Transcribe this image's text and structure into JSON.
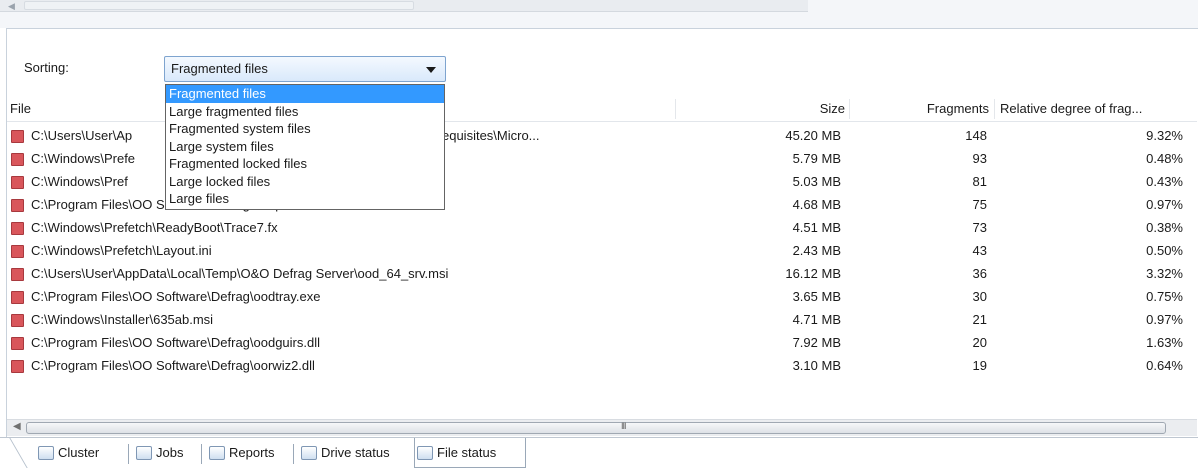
{
  "sorting": {
    "label": "Sorting:",
    "selected": "Fragmented files",
    "options": [
      "Fragmented files",
      "Large fragmented files",
      "Fragmented system files",
      "Large system files",
      "Fragmented locked files",
      "Large locked files",
      "Large files"
    ]
  },
  "columns": {
    "file": "File",
    "size": "Size",
    "fragments": "Fragments",
    "relative": "Relative degree of frag..."
  },
  "rows": [
    {
      "path": "C:\\Users\\User\\Ap",
      "path_suffix": "er\\ISSetupPrerequisites\\Micro...",
      "size": "45.20 MB",
      "fragments": "148",
      "relative": "9.32%"
    },
    {
      "path": "C:\\Windows\\Prefe",
      "path_suffix": "",
      "size": "5.79 MB",
      "fragments": "93",
      "relative": "0.48%"
    },
    {
      "path": "C:\\Windows\\Pref",
      "path_suffix": "",
      "size": "5.03 MB",
      "fragments": "81",
      "relative": "0.43%"
    },
    {
      "path": "C:\\Program Files\\OO Software\\Defrag\\oodpeo.ocx",
      "size": "4.68 MB",
      "fragments": "75",
      "relative": "0.97%"
    },
    {
      "path": "C:\\Windows\\Prefetch\\ReadyBoot\\Trace7.fx",
      "size": "4.51 MB",
      "fragments": "73",
      "relative": "0.38%"
    },
    {
      "path": "C:\\Windows\\Prefetch\\Layout.ini",
      "size": "2.43 MB",
      "fragments": "43",
      "relative": "0.50%"
    },
    {
      "path": "C:\\Users\\User\\AppData\\Local\\Temp\\O&O Defrag Server\\ood_64_srv.msi",
      "size": "16.12 MB",
      "fragments": "36",
      "relative": "3.32%"
    },
    {
      "path": "C:\\Program Files\\OO Software\\Defrag\\oodtray.exe",
      "size": "3.65 MB",
      "fragments": "30",
      "relative": "0.75%"
    },
    {
      "path": "C:\\Windows\\Installer\\635ab.msi",
      "size": "4.71 MB",
      "fragments": "21",
      "relative": "0.97%"
    },
    {
      "path": "C:\\Program Files\\OO Software\\Defrag\\oodguirs.dll",
      "size": "7.92 MB",
      "fragments": "20",
      "relative": "1.63%"
    },
    {
      "path": "C:\\Program Files\\OO Software\\Defrag\\oorwiz2.dll",
      "size": "3.10 MB",
      "fragments": "19",
      "relative": "0.64%"
    }
  ],
  "tabs": [
    {
      "label": "Cluster",
      "icon": "cluster-icon"
    },
    {
      "label": "Jobs",
      "icon": "jobs-icon"
    },
    {
      "label": "Reports",
      "icon": "reports-icon"
    },
    {
      "label": "Drive status",
      "icon": "drive-status-icon"
    },
    {
      "label": "File status",
      "icon": "file-status-icon",
      "active": true
    }
  ],
  "scrollbar": {
    "grip": "III"
  },
  "colors": {
    "fragment_marker": "#d9565b",
    "selection": "#3399ff"
  }
}
